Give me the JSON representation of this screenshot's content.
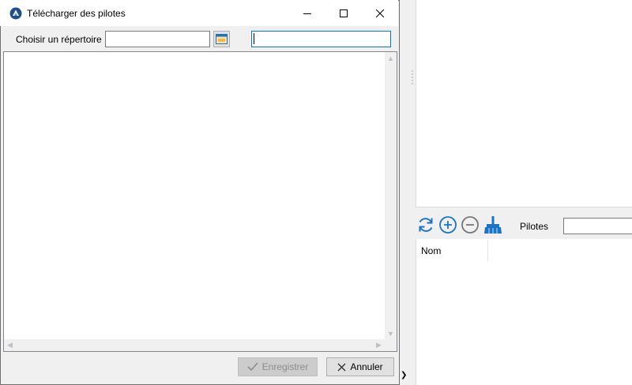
{
  "dialog": {
    "title": "Télécharger des pilotes",
    "choose_dir_label": "Choisir un répertoire",
    "dir_value": "",
    "filter_value": "",
    "save_label": "Enregistrer",
    "cancel_label": "Annuler",
    "icons": {
      "app": "app-logo-icon",
      "minimize": "minimize-icon",
      "maximize": "maximize-icon",
      "close": "close-icon",
      "browse": "folder-icon",
      "save": "checkmark-icon",
      "cancel": "x-icon"
    }
  },
  "right_panel": {
    "pilotes_label": "Pilotes",
    "pilotes_value": "",
    "column_header": "Nom",
    "toolbar_icons": [
      "refresh-icon",
      "add-icon",
      "remove-icon",
      "clean-icon"
    ]
  },
  "colors": {
    "accent": "#1a73c9",
    "focus_border": "#0078d7",
    "disabled_text": "#8d8d8d",
    "window_bg": "#f0f0f0"
  }
}
